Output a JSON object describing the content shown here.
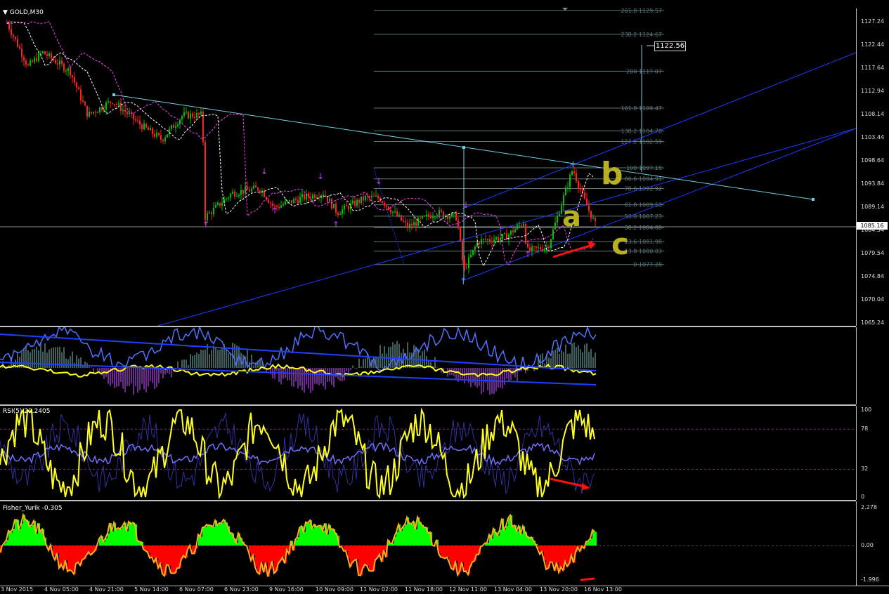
{
  "symbol": {
    "title": "GOLD,M30"
  },
  "current_price_label": "1085.16",
  "last_price_box": "1122.56",
  "annotations": {
    "b": "b",
    "a": "a",
    "c": "c"
  },
  "main_axis": [
    "1127.24",
    "1122.44",
    "1117.64",
    "1112.94",
    "1108.14",
    "1103.44",
    "1098.64",
    "1093.84",
    "1089.14",
    "1084.34",
    "1079.54",
    "1074.84",
    "1070.04",
    "1065.24"
  ],
  "fib_levels": [
    {
      "label": "261.8 1129.57",
      "price": 1129.57
    },
    {
      "label": "238.2 1124.67",
      "price": 1124.67
    },
    {
      "label": "200 1117.07",
      "price": 1117.07
    },
    {
      "label": "161.8 1109.47",
      "price": 1109.47
    },
    {
      "label": "138.2 1104.78",
      "price": 1104.78
    },
    {
      "label": "127.2 1102.59",
      "price": 1102.59
    },
    {
      "label": "100 1097.18",
      "price": 1097.18
    },
    {
      "label": "86.6 1094.91",
      "price": 1094.91
    },
    {
      "label": "78.6 1092.92",
      "price": 1092.92
    },
    {
      "label": "61.8 1089.58",
      "price": 1089.58
    },
    {
      "label": "50.0 1087.23",
      "price": 1087.23
    },
    {
      "label": "38.2 1084.88",
      "price": 1084.88
    },
    {
      "label": "23.6 1081.98",
      "price": 1081.98
    },
    {
      "label": "13.8 1080.03",
      "price": 1080.03
    },
    {
      "label": "0 1077.28",
      "price": 1077.28
    }
  ],
  "rsi": {
    "title": "RSI(5) 20.2405",
    "axis": [
      "100",
      "78",
      "32",
      "0"
    ]
  },
  "fisher": {
    "title": "Fisher_Yurik -0.305",
    "axis": [
      "2.278",
      "0.00",
      "-1.996"
    ]
  },
  "time_axis": [
    "3 Nov 2015",
    "4 Nov 05:00",
    "4 Nov 21:00",
    "5 Nov 14:00",
    "6 Nov 07:00",
    "6 Nov 23:00",
    "9 Nov 16:00",
    "10 Nov 09:00",
    "11 Nov 02:00",
    "11 Nov 18:00",
    "12 Nov 11:00",
    "13 Nov 04:00",
    "13 Nov 20:00",
    "16 Nov 13:00"
  ],
  "colors": {
    "bull": "#00c000",
    "bear": "#ff2020",
    "fib": "#607878",
    "channel": "#1a3cff",
    "trendline": "#70d0e0",
    "ma": "#ff40ff",
    "rsi": "#ffff20",
    "fisher_pos": "#00ff00",
    "fisher_neg": "#ff0000",
    "annot": "#b8b020"
  },
  "chart_data": [
    {
      "type": "candlestick",
      "title": "GOLD,M30",
      "ylim": [
        1065.24,
        1127.24
      ],
      "approx_close_path": [
        {
          "x": "3 Nov 2015",
          "y": 1127.0
        },
        {
          "x": "4 Nov 05:00",
          "y": 1118.0
        },
        {
          "x": "4 Nov 21:00",
          "y": 1111.5
        },
        {
          "x": "5 Nov 14:00",
          "y": 1106.5
        },
        {
          "x": "6 Nov 07:00",
          "y": 1108.0
        },
        {
          "x": "6 Nov 07:00",
          "y": 1087.5
        },
        {
          "x": "6 Nov 23:00",
          "y": 1092.5
        },
        {
          "x": "9 Nov 16:00",
          "y": 1091.5
        },
        {
          "x": "10 Nov 09:00",
          "y": 1088.0
        },
        {
          "x": "11 Nov 02:00",
          "y": 1090.5
        },
        {
          "x": "11 Nov 18:00",
          "y": 1087.5
        },
        {
          "x": "12 Nov 11:00",
          "y": 1076.0
        },
        {
          "x": "12 Nov 11:00",
          "y": 1083.0
        },
        {
          "x": "13 Nov 04:00",
          "y": 1082.0
        },
        {
          "x": "13 Nov 20:00",
          "y": 1097.5
        },
        {
          "x": "16 Nov 13:00",
          "y": 1085.16
        }
      ],
      "last_price": 1085.16,
      "fib_high": 1097.18,
      "fib_low": 1077.28
    },
    {
      "type": "line",
      "title": "RSI(5) 20.2405",
      "ylim": [
        0,
        100
      ],
      "levels": [
        78,
        32
      ],
      "series": [
        {
          "name": "RSI(5)",
          "last_value": 20.2405
        }
      ]
    },
    {
      "type": "area",
      "title": "Fisher_Yurik -0.305",
      "ylim": [
        -1.996,
        2.278
      ],
      "series": [
        {
          "name": "Fisher_Yurik",
          "last_value": -0.305
        }
      ]
    }
  ]
}
